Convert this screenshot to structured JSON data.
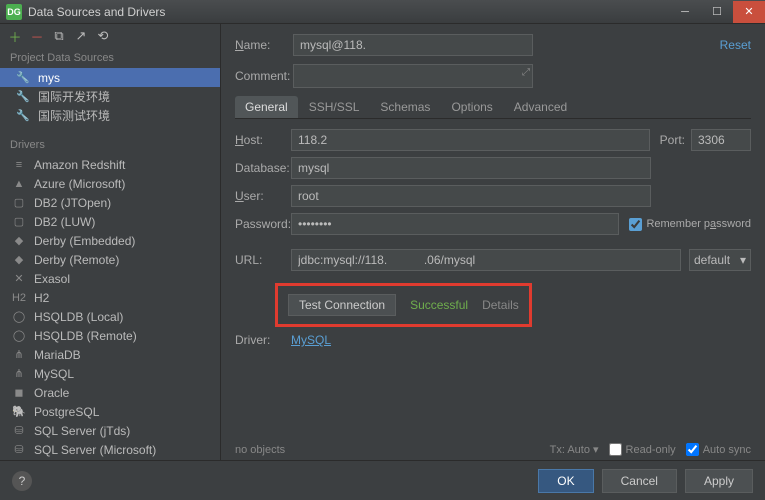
{
  "window": {
    "title": "Data Sources and Drivers"
  },
  "sidebar": {
    "sections": {
      "project": "Project Data Sources",
      "drivers": "Drivers"
    },
    "datasources": [
      {
        "label": "mys"
      },
      {
        "label": "国际开发环境"
      },
      {
        "label": "国际测试环境"
      }
    ],
    "drivers": [
      {
        "label": "Amazon Redshift"
      },
      {
        "label": "Azure (Microsoft)"
      },
      {
        "label": "DB2 (JTOpen)"
      },
      {
        "label": "DB2 (LUW)"
      },
      {
        "label": "Derby (Embedded)"
      },
      {
        "label": "Derby (Remote)"
      },
      {
        "label": "Exasol"
      },
      {
        "label": "H2"
      },
      {
        "label": "HSQLDB (Local)"
      },
      {
        "label": "HSQLDB (Remote)"
      },
      {
        "label": "MariaDB"
      },
      {
        "label": "MySQL"
      },
      {
        "label": "Oracle"
      },
      {
        "label": "PostgreSQL"
      },
      {
        "label": "SQL Server (jTds)"
      },
      {
        "label": "SQL Server (Microsoft)"
      }
    ]
  },
  "header": {
    "name_label": "Name:",
    "name_value": "mysql@118.",
    "comment_label": "Comment:",
    "reset": "Reset"
  },
  "tabs": [
    "General",
    "SSH/SSL",
    "Schemas",
    "Options",
    "Advanced"
  ],
  "form": {
    "host_label": "Host:",
    "host_value": "118.2",
    "port_label": "Port:",
    "port_value": "3306",
    "database_label": "Database:",
    "database_value": "mysql",
    "user_label": "User:",
    "user_value": "root",
    "password_label": "Password:",
    "password_value": "••••••••",
    "remember_label": "Remember password",
    "url_label": "URL:",
    "url_value": "jdbc:mysql://118.           .06/mysql",
    "default_label": "default",
    "test_btn": "Test Connection",
    "success": "Successful",
    "details": "Details",
    "driver_label": "Driver:",
    "driver_value": "MySQL"
  },
  "status": {
    "no_objects": "no objects",
    "tx_auto": "Tx: Auto",
    "read_only": "Read-only",
    "auto_sync": "Auto sync"
  },
  "footer": {
    "ok": "OK",
    "cancel": "Cancel",
    "apply": "Apply"
  }
}
